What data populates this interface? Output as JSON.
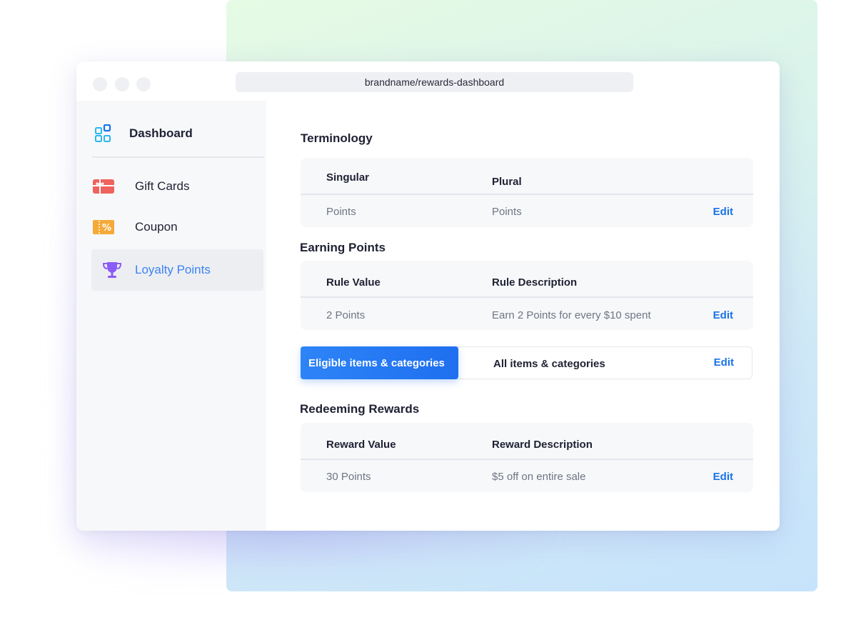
{
  "browser": {
    "url": "brandname/rewards-dashboard"
  },
  "sidebar": {
    "items": [
      {
        "label": "Dashboard",
        "icon": "dashboard-grid-icon"
      },
      {
        "label": "Gift Cards",
        "icon": "gift-card-icon"
      },
      {
        "label": "Coupon",
        "icon": "coupon-icon"
      },
      {
        "label": "Loyalty Points",
        "icon": "trophy-icon",
        "active": true
      }
    ]
  },
  "terminology": {
    "title": "Terminology",
    "headers": [
      "Singular",
      "Plural"
    ],
    "values": [
      "Points",
      "Points"
    ],
    "edit_label": "Edit"
  },
  "earning": {
    "title": "Earning Points",
    "headers": [
      "Rule Value",
      "Rule Description"
    ],
    "values": [
      "2 Points",
      "Earn 2 Points for every $10 spent"
    ],
    "edit_label": "Edit"
  },
  "eligibility": {
    "tab_label": "Eligible items & categories",
    "value": "All items & categories",
    "edit_label": "Edit"
  },
  "redeeming": {
    "title": "Redeeming Rewards",
    "headers": [
      "Reward Value",
      "Reward Description"
    ],
    "values": [
      "30 Points",
      "$5 off on entire sale"
    ],
    "edit_label": "Edit"
  },
  "colors": {
    "accent": "#1a73e8",
    "active_nav": "#3b82f6",
    "gift_card": "#f0625d",
    "coupon": "#f5a937",
    "trophy": "#8b5cf6",
    "dashboard_icon": "#2bb7f0"
  }
}
